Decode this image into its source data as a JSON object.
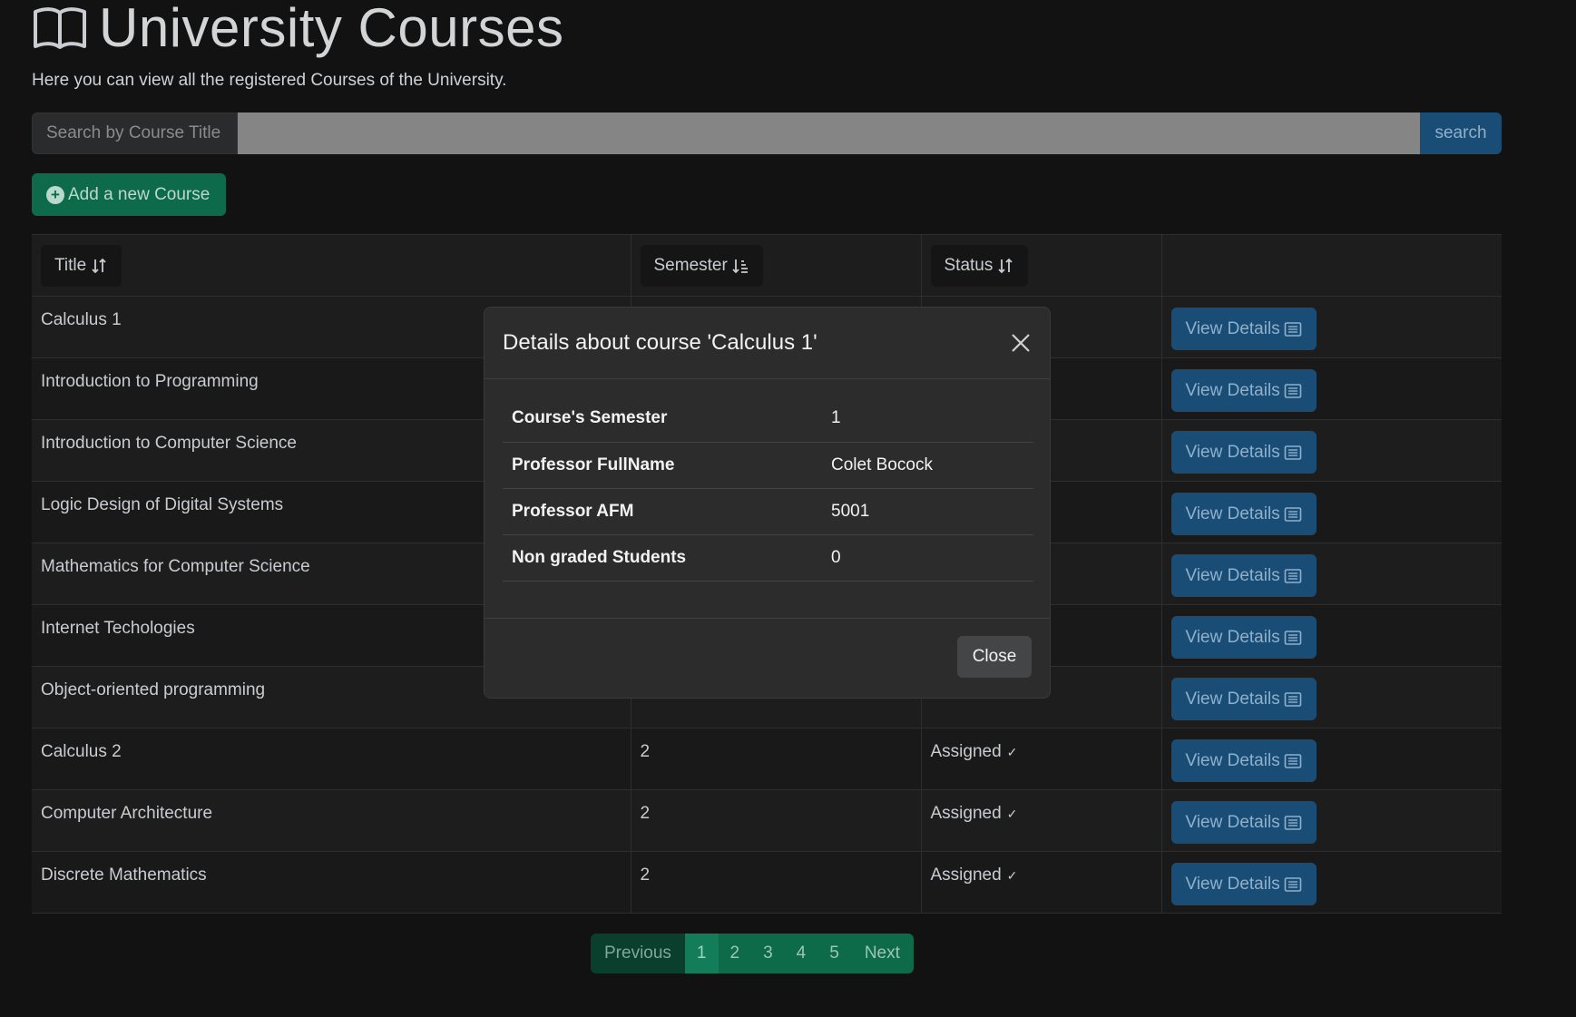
{
  "header": {
    "title": "University Courses",
    "subtitle": "Here you can view all the registered Courses of the University."
  },
  "search": {
    "label": "Search by Course Title",
    "value": "",
    "button": "search"
  },
  "add_button": "Add a new Course",
  "table": {
    "headers": {
      "title": "Title",
      "semester": "Semester",
      "status": "Status"
    },
    "view_label": "View Details",
    "rows": [
      {
        "title": "Calculus 1",
        "semester": "",
        "status": ""
      },
      {
        "title": "Introduction to Programming",
        "semester": "",
        "status": ""
      },
      {
        "title": "Introduction to Computer Science",
        "semester": "",
        "status": ""
      },
      {
        "title": "Logic Design of Digital Systems",
        "semester": "",
        "status": ""
      },
      {
        "title": "Mathematics for Computer Science",
        "semester": "",
        "status": ""
      },
      {
        "title": "Internet Techologies",
        "semester": "",
        "status": ""
      },
      {
        "title": "Object-oriented programming",
        "semester": "",
        "status": ""
      },
      {
        "title": "Calculus 2",
        "semester": "2",
        "status": "Assigned"
      },
      {
        "title": "Computer Architecture",
        "semester": "2",
        "status": "Assigned"
      },
      {
        "title": "Discrete Mathematics",
        "semester": "2",
        "status": "Assigned"
      }
    ]
  },
  "pagination": {
    "previous": "Previous",
    "pages": [
      "1",
      "2",
      "3",
      "4",
      "5"
    ],
    "active": "1",
    "next": "Next"
  },
  "modal": {
    "title": "Details about course 'Calculus 1'",
    "details": [
      {
        "key": "Course's Semester",
        "value": "1"
      },
      {
        "key": "Professor FullName",
        "value": "Colet Bocock"
      },
      {
        "key": "Professor AFM",
        "value": "5001"
      },
      {
        "key": "Non graded Students",
        "value": "0"
      }
    ],
    "close_label": "Close"
  },
  "colors": {
    "background": "#121212",
    "primary": "#1a4d76",
    "success": "#0d6b4c",
    "modal": "#2c2c2c"
  }
}
